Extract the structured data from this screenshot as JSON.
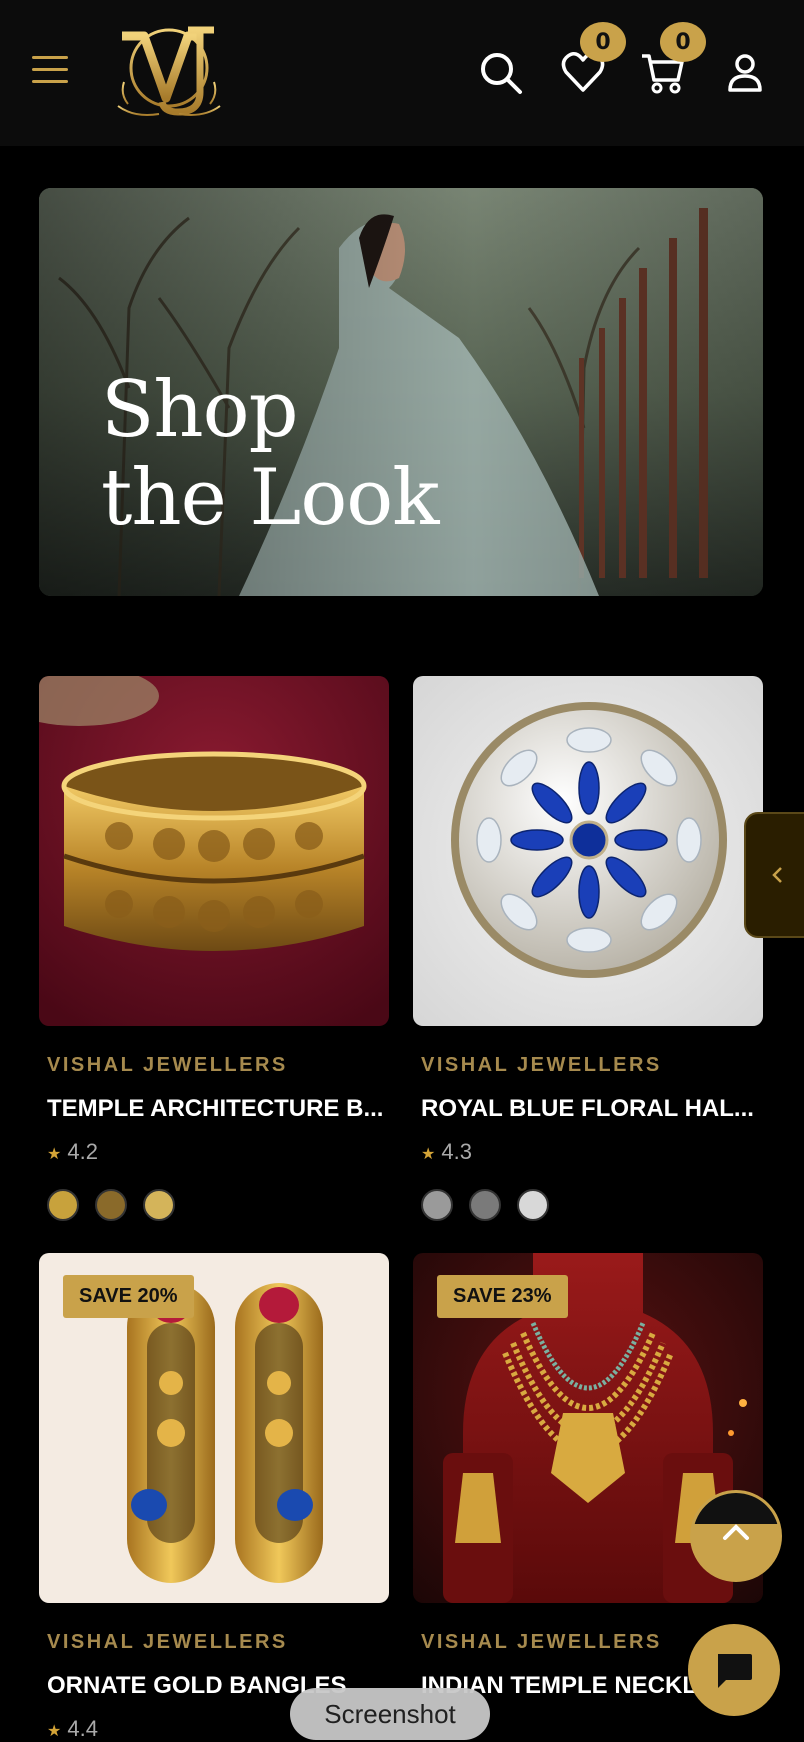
{
  "header": {
    "menu_icon": "hamburger-icon",
    "logo_icon": "vj-monogram-logo",
    "search_icon": "search-icon",
    "wishlist_icon": "heart-icon",
    "wishlist_count": "0",
    "cart_icon": "cart-icon",
    "cart_count": "0",
    "account_icon": "user-icon"
  },
  "hero": {
    "title_line1": "Shop",
    "title_line2": "the Look"
  },
  "products": [
    {
      "brand": "VISHAL JEWELLERS",
      "name": "TEMPLE ARCHITECTURE B...",
      "rating": "4.2",
      "swatches": [
        "#c8a23c",
        "#8a6a2a",
        "#d4b45a"
      ]
    },
    {
      "brand": "VISHAL JEWELLERS",
      "name": "ROYAL BLUE FLORAL HAL...",
      "rating": "4.3",
      "swatches": [
        "#9a9a9a",
        "#7a7a7a",
        "#d8d8d8"
      ]
    },
    {
      "brand": "VISHAL JEWELLERS",
      "name": "ORNATE GOLD BANGLES",
      "rating": "4.4",
      "badge": "SAVE 20%"
    },
    {
      "brand": "VISHAL JEWELLERS",
      "name": "INDIAN TEMPLE NECKL",
      "badge": "SAVE 23%"
    }
  ],
  "overlays": {
    "side_tab_icon": "chevron-left-icon",
    "scroll_top_icon": "chevron-up-icon",
    "chat_icon": "chat-icon",
    "screenshot_label": "Screenshot"
  },
  "colors": {
    "accent_gold": "#c9a24a",
    "brand_text": "#a68a4e",
    "background": "#000000"
  }
}
